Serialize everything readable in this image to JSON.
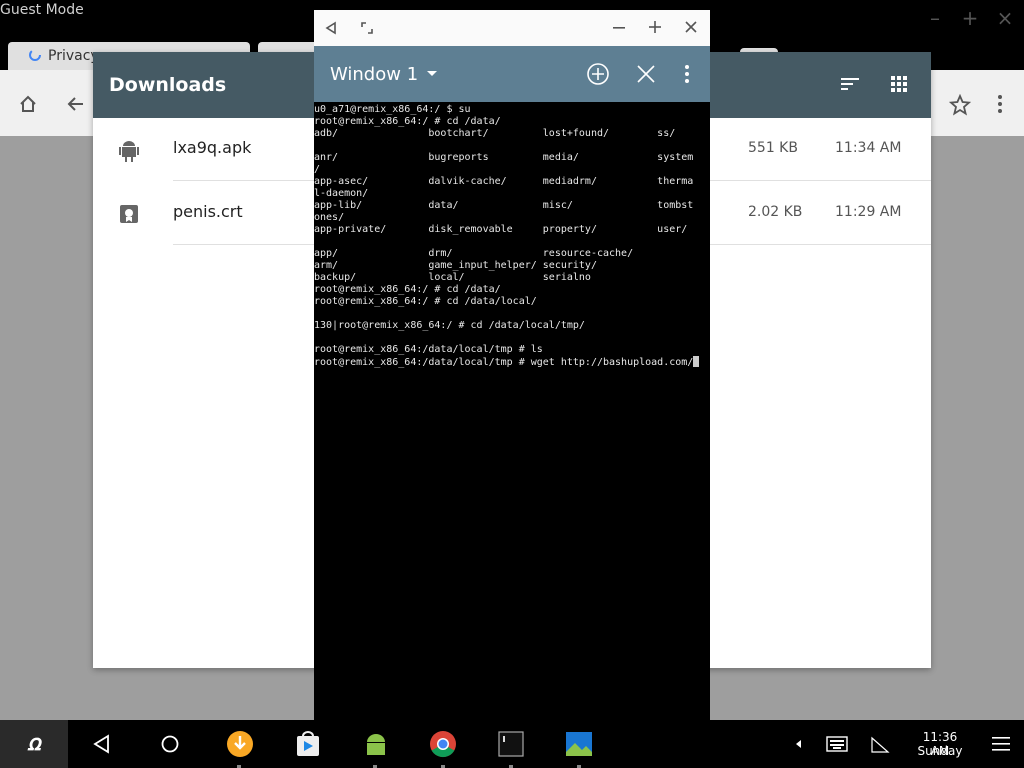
{
  "chrome": {
    "guest_mode_label": "Guest Mode",
    "tab_privacy_label": "Privacy",
    "colors": {
      "chrome_bg": "#000000",
      "omnibar_bg": "#f0f0f0"
    }
  },
  "downloads": {
    "title": "Downloads",
    "header_color": "#455a64",
    "items": [
      {
        "icon": "android-icon",
        "name": "lxa9q.apk",
        "size": "551 KB",
        "time": "11:34 AM"
      },
      {
        "icon": "certificate-icon",
        "name": "penis.crt",
        "size": "2.02 KB",
        "time": "11:29 AM"
      }
    ]
  },
  "terminal": {
    "window_name": "Window 1",
    "toolbar_color": "#5e7f93",
    "lines": [
      "u0_a71@remix_x86_64:/ $ su",
      "root@remix_x86_64:/ # cd /data/",
      "adb/               bootchart/         lost+found/        ss/",
      "",
      "anr/               bugreports         media/             system",
      "/",
      "app-asec/          dalvik-cache/      mediadrm/          therma",
      "l-daemon/",
      "app-lib/           data/              misc/              tombst",
      "ones/",
      "app-private/       disk_removable     property/          user/",
      "",
      "app/               drm/               resource-cache/",
      "arm/               game_input_helper/ security/",
      "backup/            local/             serialno",
      "root@remix_x86_64:/ # cd /data/",
      "root@remix_x86_64:/ # cd /data/local/",
      "",
      "130|root@remix_x86_64:/ # cd /data/local/tmp/",
      "",
      "root@remix_x86_64:/data/local/tmp # ls",
      "root@remix_x86_64:/data/local/tmp # wget http://bashupload.com/"
    ]
  },
  "taskbar": {
    "start_label": "ꭥ",
    "time": "11:36 AM",
    "day": "Sunday"
  }
}
